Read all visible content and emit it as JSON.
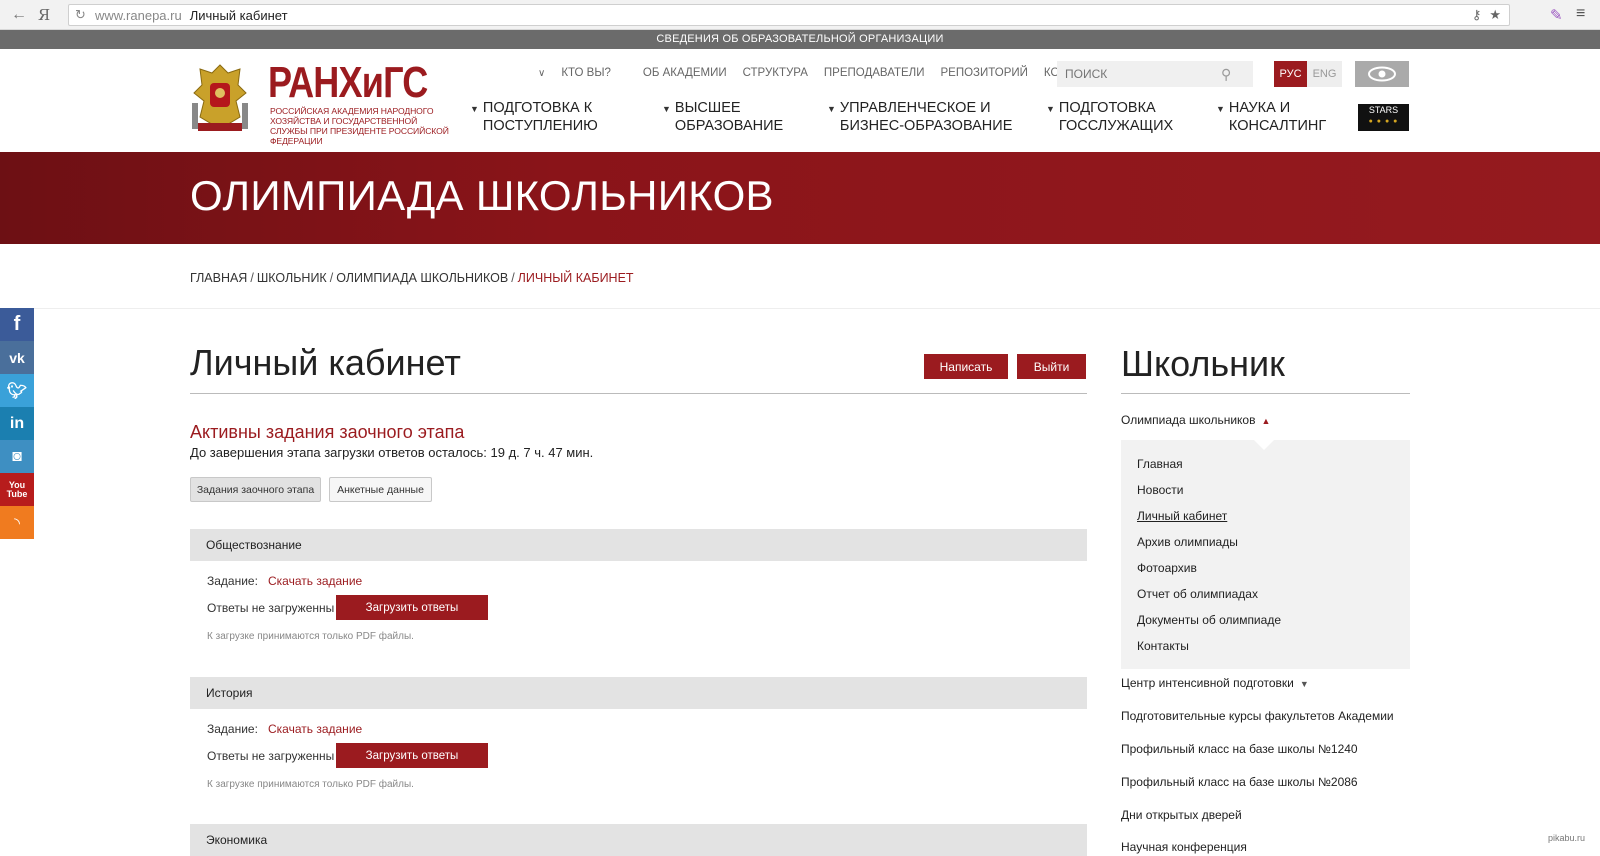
{
  "browser": {
    "back": "←",
    "yandex": "Я",
    "domain": "www.ranepa.ru",
    "tab_title": "Личный кабинет"
  },
  "info_bar": "СВЕДЕНИЯ ОБ ОБРАЗОВАТЕЛЬНОЙ ОРГАНИЗАЦИИ",
  "logo": {
    "main": "РАНХиГС",
    "sub": "Российская академия народного хозяйства и государственной службы при президенте Российской Федерации"
  },
  "topnav": [
    "КТО ВЫ?",
    "ОБ АКАДЕМИИ",
    "СТРУКТУРА",
    "ПРЕПОДАВАТЕЛИ",
    "РЕПОЗИТОРИЙ",
    "КОНТАКТЫ"
  ],
  "search": {
    "placeholder": "ПОИСК"
  },
  "lang": {
    "ru": "РУС",
    "en": "ENG"
  },
  "mainnav": [
    {
      "line1": "ПОДГОТОВКА К",
      "line2": "ПОСТУПЛЕНИЮ"
    },
    {
      "line1": "ВЫСШЕЕ",
      "line2": "ОБРАЗОВАНИЕ"
    },
    {
      "line1": "УПРАВЛЕНЧЕСКОЕ И",
      "line2": "БИЗНЕС-ОБРАЗОВАНИЕ"
    },
    {
      "line1": "ПОДГОТОВКА",
      "line2": "ГОССЛУЖАЩИХ"
    },
    {
      "line1": "НАУКА И",
      "line2": "КОНСАЛТИНГ"
    }
  ],
  "stars_badge": "STARS",
  "banner_title": "ОЛИМПИАДА ШКОЛЬНИКОВ",
  "breadcrumb": {
    "items": [
      "ГЛАВНАЯ",
      "ШКОЛЬНИК",
      "ОЛИМПИАДА ШКОЛЬНИКОВ"
    ],
    "current": "ЛИЧНЫЙ КАБИНЕТ",
    "separator": "/"
  },
  "main": {
    "title": "Личный кабинет",
    "write_button": "Написать",
    "exit_button": "Выйти",
    "active_heading": "Активны задания заочного этапа",
    "active_sub": "До завершения этапа загрузки ответов осталось: 19 д. 7 ч. 47 мин.",
    "tabs": [
      "Задания заочного этапа",
      "Анкетные данные"
    ],
    "task_label": "Задание:",
    "download_link": "Скачать задание",
    "status_label": "Ответы не загруженны",
    "upload_button": "Загрузить ответы",
    "note": "К загрузке принимаются только PDF файлы.",
    "subjects": [
      "Обществознание",
      "История",
      "Экономика"
    ]
  },
  "sidebar": {
    "title": "Школьник",
    "parent": "Олимпиада школьников",
    "links": [
      "Главная",
      "Новости",
      "Личный кабинет",
      "Архив олимпиады",
      "Фотоархив",
      "Отчет об олимпиадах",
      "Документы об олимпиаде",
      "Контакты"
    ],
    "more": [
      "Центр интенсивной подготовки",
      "Подготовительные курсы факультетов Академии",
      "Профильный класс на базе школы №1240",
      "Профильный класс на базе школы №2086",
      "Дни открытых дверей",
      "Научная конференция"
    ]
  },
  "watermark": "pikabu.ru"
}
